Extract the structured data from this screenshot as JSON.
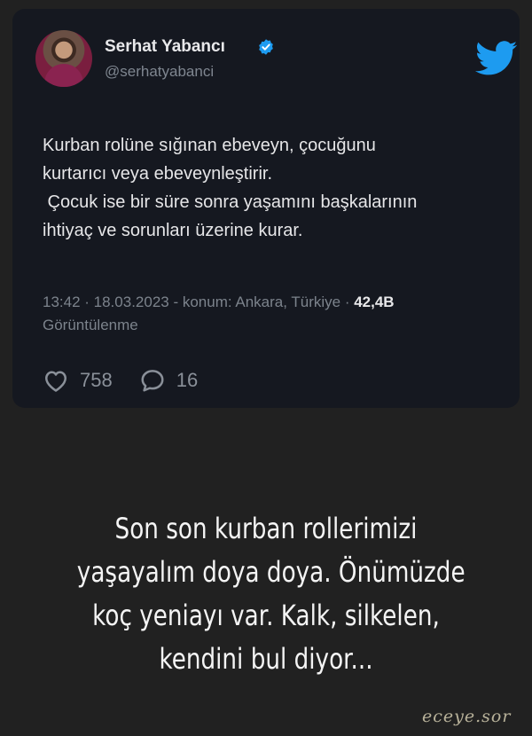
{
  "tweet": {
    "display_name": "Serhat Yabancı",
    "handle": "@serhatyabanci",
    "text_lines": [
      "Kurban rolüne sığınan ebeveyn, çocuğunu",
      "kurtarıcı veya ebeveynleştirir.",
      " Çocuk ise bir süre sonra yaşamını başkalarının",
      "ihtiyaç ve sorunları üzerine kurar."
    ],
    "meta_prefix": "13:42 · 18.03.2023 - konum: Ankara, Türkiye · ",
    "views_count": "42,4B",
    "views_label": "Görüntülenme",
    "likes": "758",
    "replies": "16",
    "accent_color": "#1d9bf0",
    "icons": [
      "verified-badge-icon",
      "twitter-bird-icon",
      "heart-icon",
      "reply-bubble-icon"
    ]
  },
  "caption": {
    "lines": [
      "Son son kurban rollerimizi",
      "yaşayalım doya doya. Önümüzde",
      "koç yeniayı var. Kalk, silkelen,",
      "kendini bul diyor..."
    ]
  },
  "watermark": "eceye.sor"
}
